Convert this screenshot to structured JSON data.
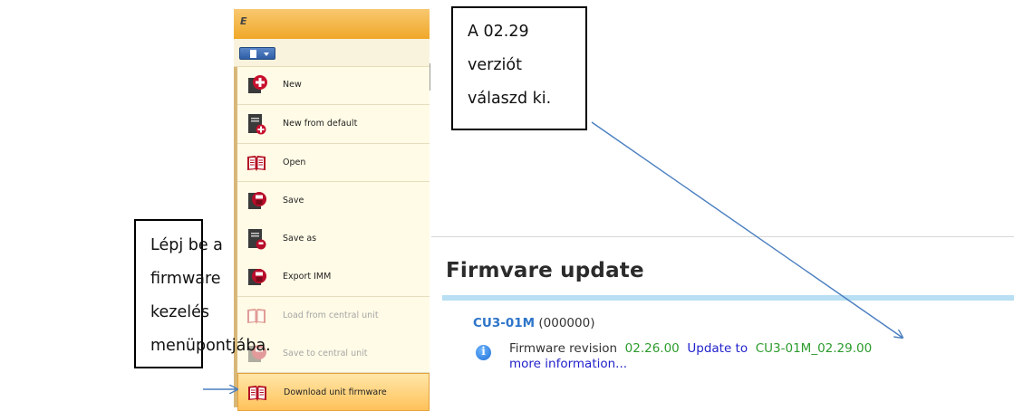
{
  "app": {
    "logo": "E",
    "menu_items": [
      {
        "label": "New",
        "icon": "new-document-icon",
        "disabled": false
      },
      {
        "label": "New from default",
        "icon": "new-from-default-icon",
        "disabled": false
      },
      {
        "label": "Open",
        "icon": "open-book-icon",
        "disabled": false
      },
      {
        "label": "Save",
        "icon": "save-icon",
        "disabled": false
      },
      {
        "label": "Save as",
        "icon": "save-as-icon",
        "disabled": false
      },
      {
        "label": "Export IMM",
        "icon": "export-icon",
        "disabled": false
      },
      {
        "label": "Load from central unit",
        "icon": "load-book-icon",
        "disabled": true
      },
      {
        "label": "Save to central unit",
        "icon": "save-central-icon",
        "disabled": true
      },
      {
        "label": "Download unit firmware",
        "icon": "firmware-book-icon",
        "disabled": false
      }
    ]
  },
  "firmware": {
    "title": "Firmvare update",
    "unit_model": "CU3-01M",
    "unit_serial": "(000000)",
    "revision_label": "Firmware revision",
    "revision_value": "02.26.00",
    "update_label": "Update to",
    "update_target": "CU3-01M_02.29.00",
    "more_info": "more information..."
  },
  "callouts": {
    "left": [
      "Lépj be a",
      "firmware",
      "kezelés",
      "menüpontjába."
    ],
    "right": [
      "A 02.29",
      "verziót",
      "válaszd ki."
    ]
  },
  "colors": {
    "title_bar": "#f0a828",
    "menu_bg": "#fffbe6",
    "highlight": "#ffc25a",
    "accent_bar": "#b8dff3",
    "model_blue": "#2e75c9",
    "value_green": "#2d9c2d",
    "link_blue": "#2222cc",
    "arrow_blue": "#4a7fc0"
  }
}
